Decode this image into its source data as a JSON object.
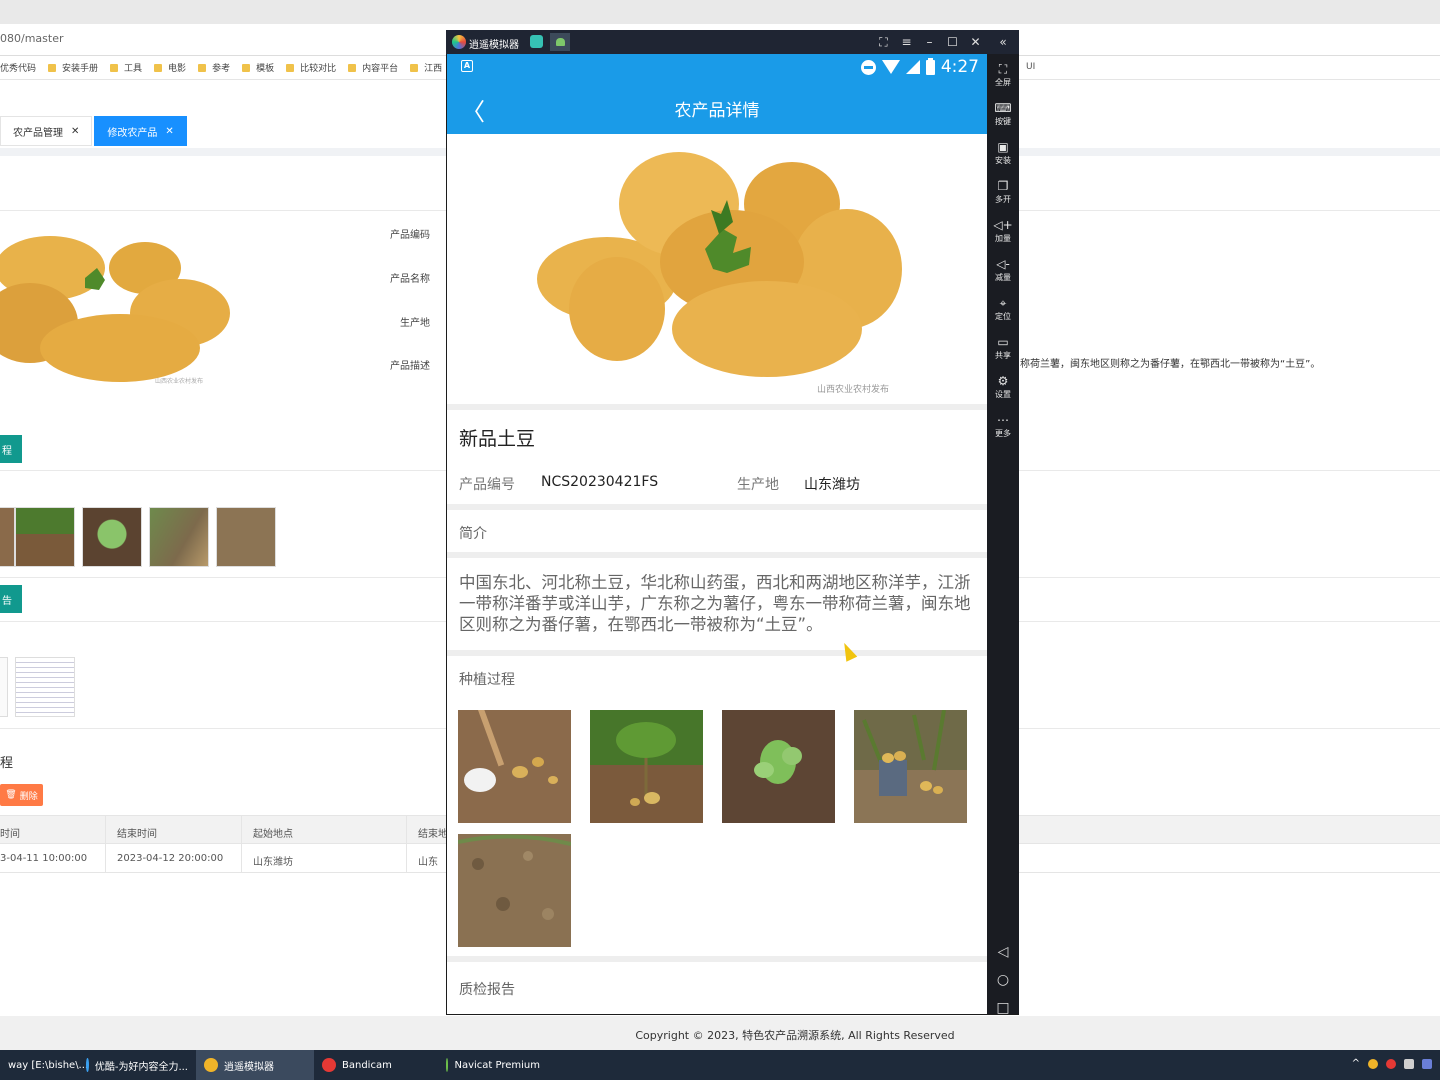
{
  "browser": {
    "address": "080/master",
    "bookmarks": [
      "优秀代码",
      "安装手册",
      "工具",
      "电影",
      "参考",
      "模板",
      "比较对比",
      "内容平台",
      "江西"
    ],
    "right_fragment": "UI"
  },
  "admin": {
    "tabs": [
      {
        "label": "农产品管理",
        "active": false
      },
      {
        "label": "修改农产品",
        "active": true
      }
    ],
    "form_labels": [
      "产品编码",
      "产品名称",
      "生产地",
      "产品描述"
    ],
    "section_btn_1": "程",
    "section_btn_2": "告",
    "desc_fragment": "称荷兰薯，闽东地区则称之为番仔薯，在鄂西北一带被称为“土豆”。",
    "section_title": "程",
    "delete_button": "删除",
    "table_headers": [
      "时间",
      "结束时间",
      "起始地点",
      "结束地"
    ],
    "table_rows": [
      [
        "3-04-11 10:00:00",
        "2023-04-12 20:00:00",
        "山东潍坊",
        "山东"
      ]
    ],
    "copyright": "Copyright © 2023, 特色农产品溯源系统, All Rights Reserved"
  },
  "taskbar": {
    "items": [
      {
        "label": "way [E:\\bishe\\...",
        "color": "#3c7bd8"
      },
      {
        "label": "优酷-为好内容全力...",
        "color": "#3aa0f0"
      },
      {
        "label": "逍遥模拟器",
        "color": "#f0b429",
        "active": true
      },
      {
        "label": "Bandicam",
        "color": "#e53935"
      },
      {
        "label": "Navicat Premium",
        "color": "#6dbf4b"
      }
    ]
  },
  "emulator": {
    "title": "逍遥模拟器",
    "window_controls": [
      "⛶",
      "≡",
      "–",
      "☐",
      "✕",
      "«"
    ],
    "tools": [
      {
        "icon": "⛶",
        "label": "全屏"
      },
      {
        "icon": "⌨",
        "label": "按键"
      },
      {
        "icon": "▣",
        "label": "安装"
      },
      {
        "icon": "❐",
        "label": "多开"
      },
      {
        "icon": "◁+",
        "label": "加量"
      },
      {
        "icon": "◁-",
        "label": "减量"
      },
      {
        "icon": "⌖",
        "label": "定位"
      },
      {
        "icon": "▭",
        "label": "共享"
      },
      {
        "icon": "⚙",
        "label": "设置"
      },
      {
        "icon": "⋯",
        "label": "更多"
      }
    ],
    "nav": [
      "◁",
      "○",
      "□"
    ]
  },
  "phone": {
    "status_time": "4:27",
    "app_title": "农产品详情",
    "product_name": "新品土豆",
    "code_label": "产品编号",
    "code_value": "NCS20230421FS",
    "origin_label": "生产地",
    "origin_value": "山东潍坊",
    "intro_label": "简介",
    "intro_text": "中国东北、河北称土豆，华北称山药蛋，西北和两湖地区称洋芋，江浙一带称洋番芋或洋山芋，广东称之为薯仔，粤东一带称荷兰薯，闽东地区则称之为番仔薯，在鄂西北一带被称为“土豆”。",
    "process_label": "种植过程",
    "qc_label": "质检报告",
    "watermark": "山西农业农村发布"
  }
}
